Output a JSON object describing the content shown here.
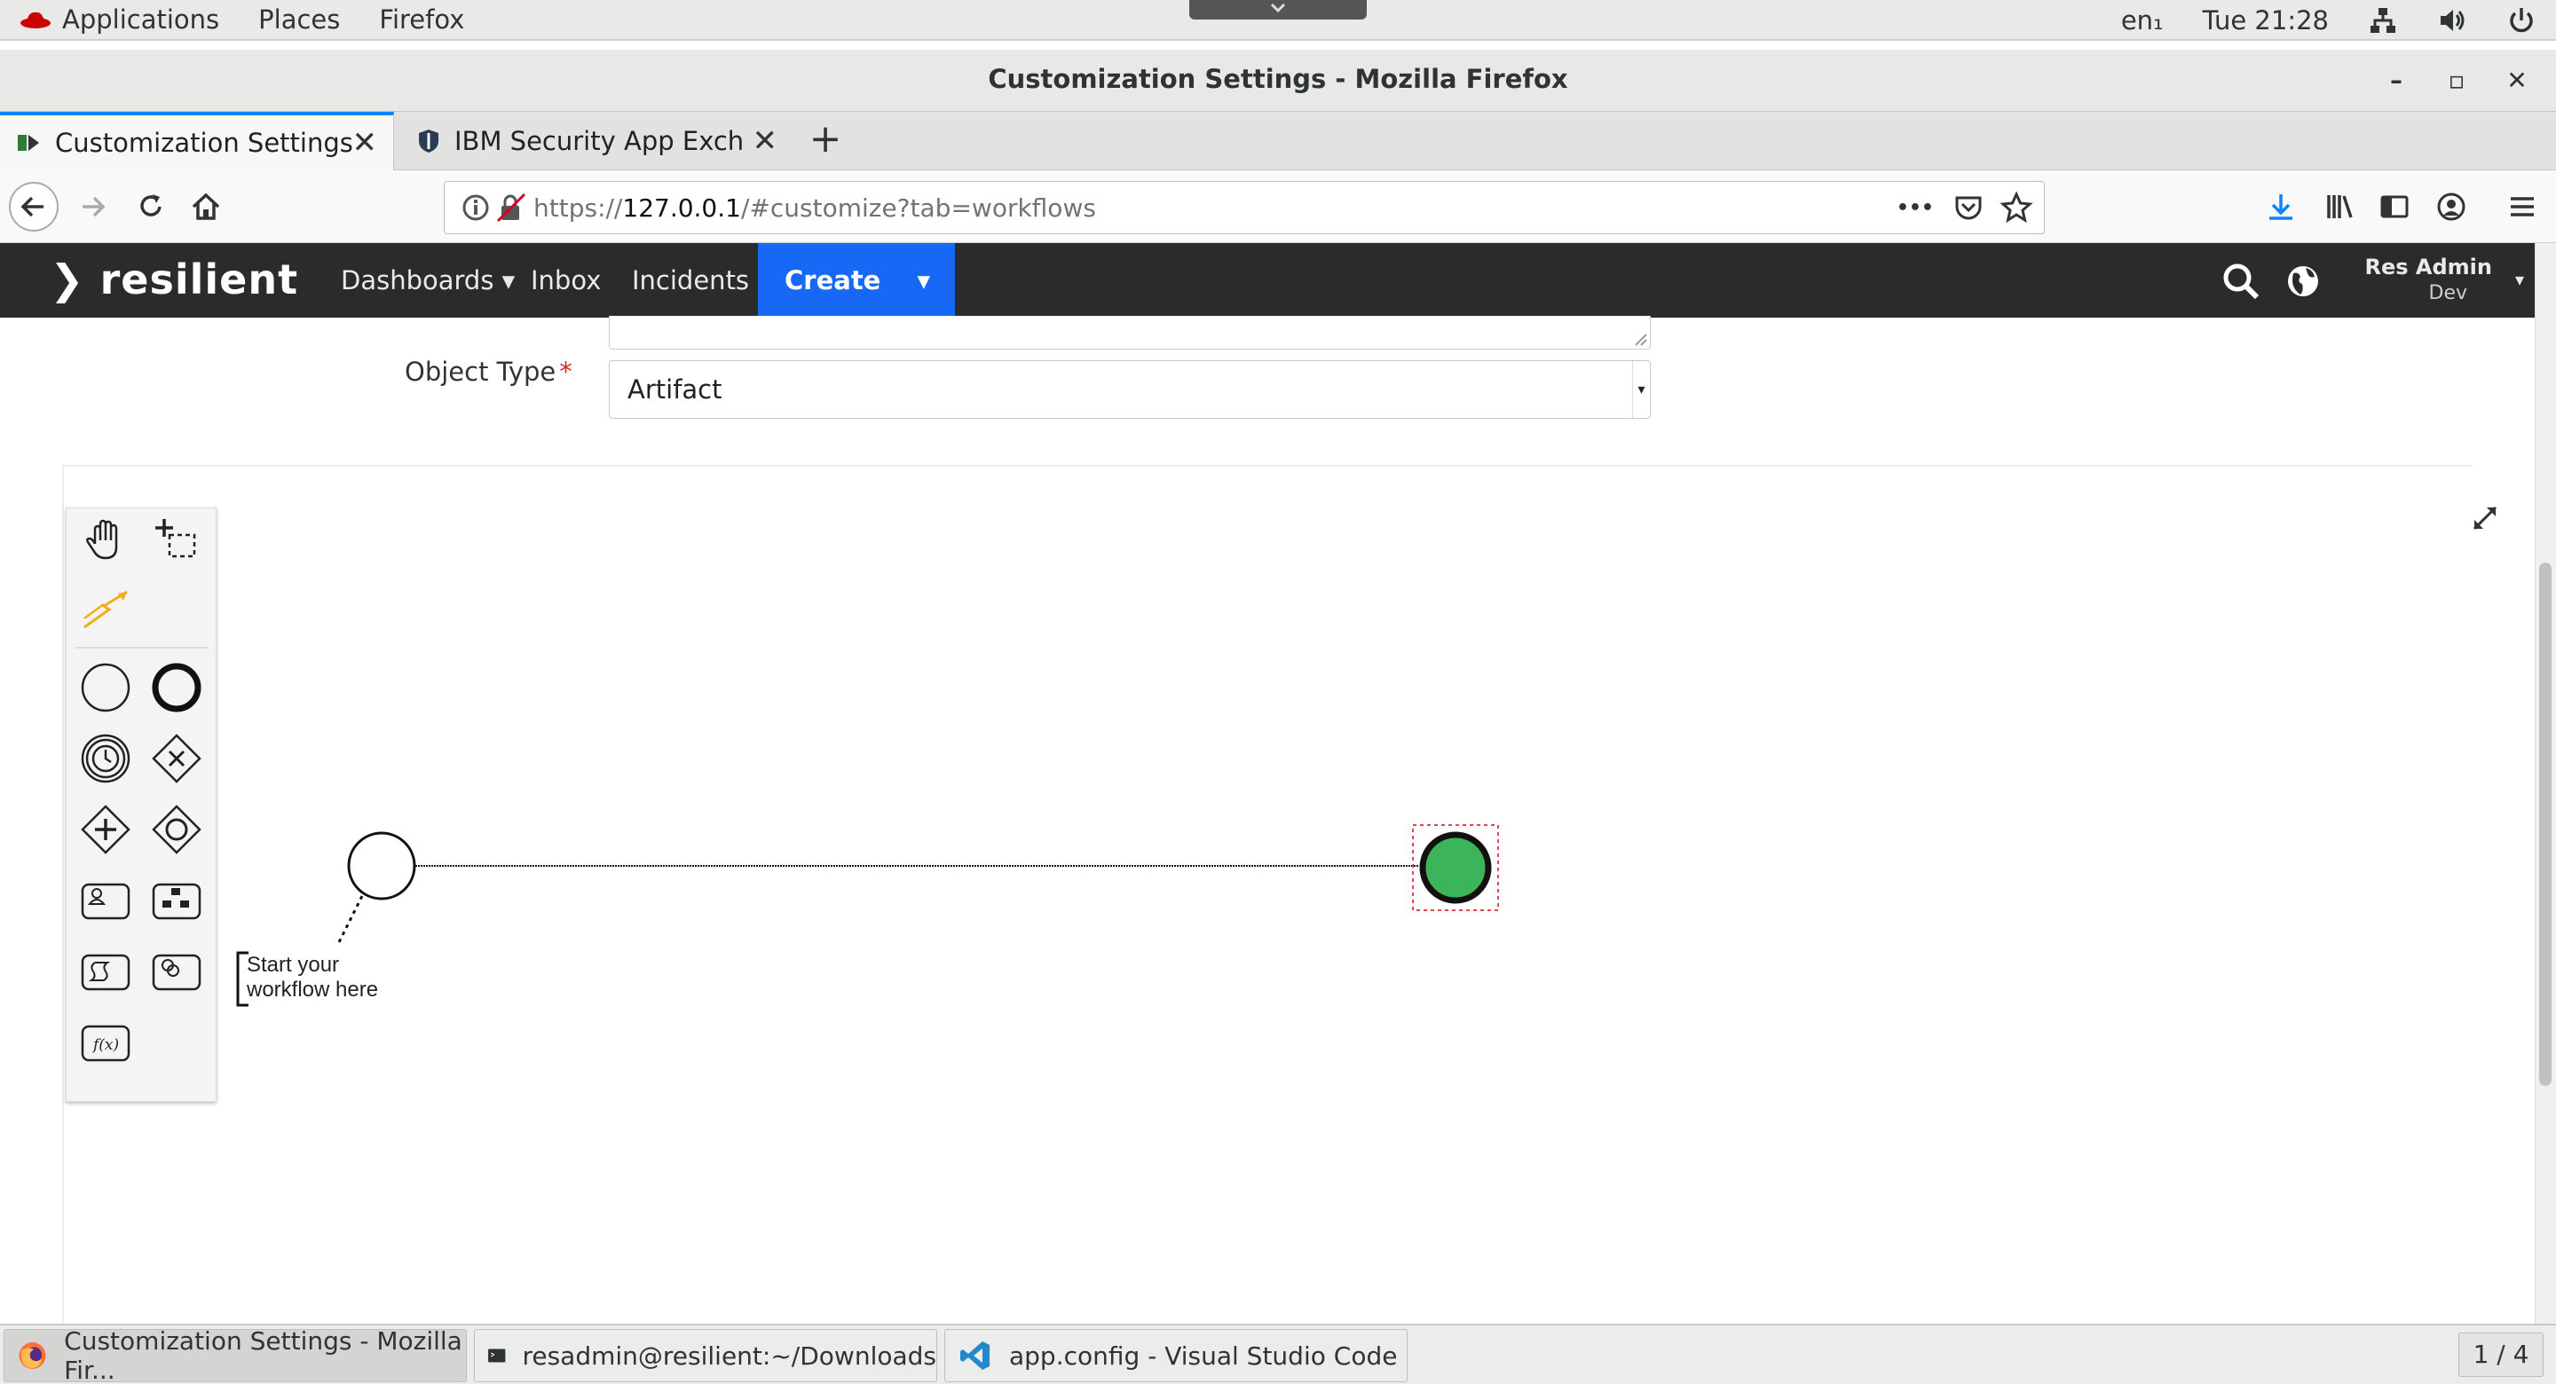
{
  "topbar": {
    "applications": "Applications",
    "places": "Places",
    "firefox": "Firefox",
    "lang": "en₁",
    "clock": "Tue 21:28"
  },
  "window": {
    "title": "Customization Settings - Mozilla Firefox",
    "minimize": "–",
    "maximize": "▫",
    "close": "✕"
  },
  "tabs": [
    {
      "label": "Customization Settings",
      "close": "✕"
    },
    {
      "label": "IBM Security App Exchange",
      "close": "✕"
    }
  ],
  "newtab": "+",
  "url": {
    "prefix": "https://",
    "host": "127.0.0.1",
    "path": "/#customize?tab=workflows",
    "more": "•••"
  },
  "app": {
    "logo": "resilient",
    "nav": [
      "Dashboards",
      "Inbox",
      "Incidents"
    ],
    "dropdown_caret": "▾",
    "create": "Create",
    "user_name": "Res Admin",
    "user_org": "Dev"
  },
  "form": {
    "object_type_label": "Object Type",
    "required_mark": "*",
    "object_type_value": "Artifact",
    "select_arrow": "▾"
  },
  "workflow": {
    "annotation_line1": "Start your",
    "annotation_line2": "workflow here"
  },
  "taskbar": [
    {
      "label": "Customization Settings - Mozilla Fir..."
    },
    {
      "label": "resadmin@resilient:~/Downloads"
    },
    {
      "label": "app.config - Visual Studio Code"
    }
  ],
  "pager": "1 / 4",
  "colors": {
    "accent_blue": "#1668f5",
    "end_event_green": "#3cb55a",
    "header_dark": "#2b2b2b"
  }
}
